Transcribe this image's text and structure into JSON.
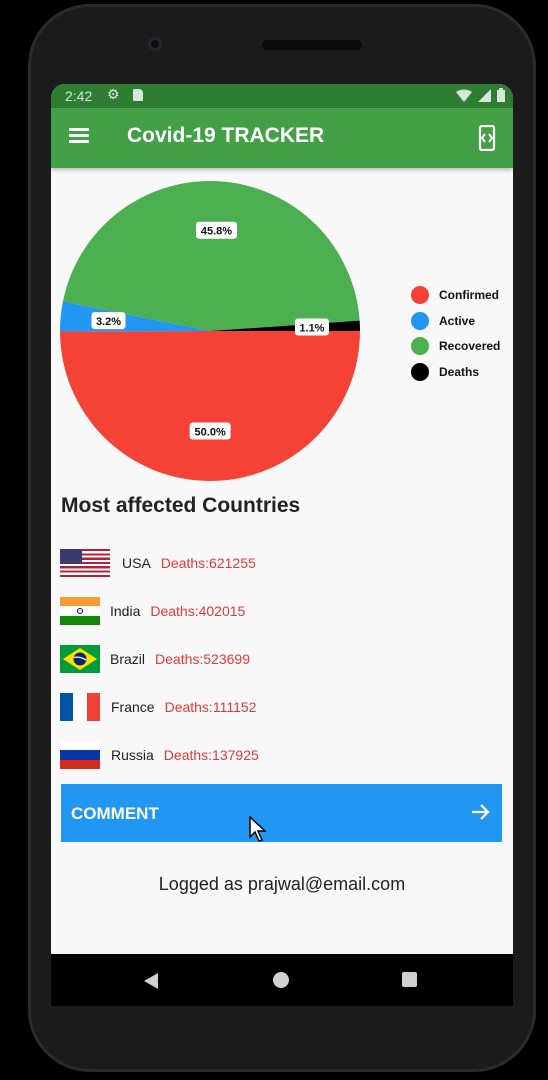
{
  "status": {
    "time": "2:42"
  },
  "appbar": {
    "title": "Covid-19 TRACKER"
  },
  "chart_data": {
    "type": "pie",
    "labels": [
      "Confirmed",
      "Active",
      "Recovered",
      "Deaths"
    ],
    "values": [
      50.0,
      3.2,
      45.8,
      1.1
    ],
    "value_labels": [
      "50.0%",
      "3.2%",
      "45.8%",
      "1.1%"
    ],
    "colors": [
      "#f44336",
      "#2196f3",
      "#4caf50",
      "#000000"
    ],
    "legend_placement": "right"
  },
  "section": {
    "title": "Most affected Countries"
  },
  "countries": [
    {
      "name": "USA",
      "deaths": "Deaths:621255",
      "flag": "us-flag"
    },
    {
      "name": "India",
      "deaths": "Deaths:402015",
      "flag": "india-flag"
    },
    {
      "name": "Brazil",
      "deaths": "Deaths:523699",
      "flag": "brazil-flag"
    },
    {
      "name": "France",
      "deaths": "Deaths:111152",
      "flag": "france-flag"
    },
    {
      "name": "Russia",
      "deaths": "Deaths:137925",
      "flag": "russia-flag"
    }
  ],
  "comment": {
    "label": "COMMENT"
  },
  "footer": {
    "logged_text": "Logged as prajwal@email.com"
  },
  "colors": {
    "appbar": "#43a047",
    "statusbar": "#2e7d32",
    "button": "#2196f3",
    "death_text": "#e53935"
  }
}
